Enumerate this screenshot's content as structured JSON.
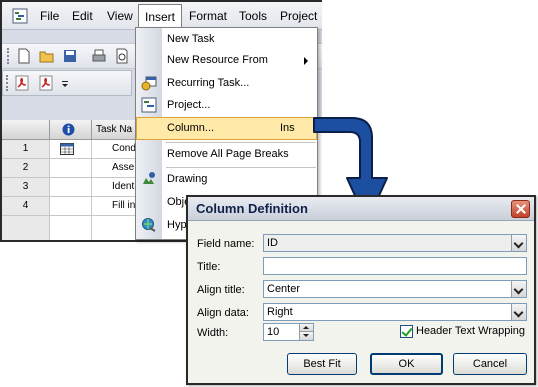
{
  "menubar": {
    "items": [
      "File",
      "Edit",
      "View",
      "Insert",
      "Format",
      "Tools",
      "Project"
    ]
  },
  "grid": {
    "headers": {
      "info": "i",
      "task": "Task Na"
    },
    "rows": [
      {
        "num": "1",
        "text": "Cond"
      },
      {
        "num": "2",
        "text": "Asse"
      },
      {
        "num": "3",
        "text": "Ident"
      },
      {
        "num": "4",
        "text": "Fill in"
      }
    ]
  },
  "insert_menu": {
    "items": [
      {
        "label": "New Task"
      },
      {
        "label": "New Resource From"
      },
      {
        "label": "Recurring Task..."
      },
      {
        "label": "Project..."
      },
      {
        "label": "Column...",
        "shortcut": "Ins"
      },
      {
        "label": "Remove All Page Breaks"
      },
      {
        "label": "Drawing"
      },
      {
        "label": "Obje"
      },
      {
        "label": "Hyp"
      }
    ]
  },
  "dialog": {
    "title": "Column Definition",
    "field_name_label": "Field name:",
    "field_name_value": "ID",
    "title_label": "Title:",
    "title_value": "",
    "align_title_label": "Align title:",
    "align_title_value": "Center",
    "align_data_label": "Align data:",
    "align_data_value": "Right",
    "width_label": "Width:",
    "width_value": "10",
    "wrap_label": "Header Text Wrapping",
    "wrap_checked": true,
    "best_fit": "Best Fit",
    "ok": "OK",
    "cancel": "Cancel"
  },
  "colors": {
    "highlight": "#ffe9a8",
    "arrow": "#1c4fa0"
  }
}
